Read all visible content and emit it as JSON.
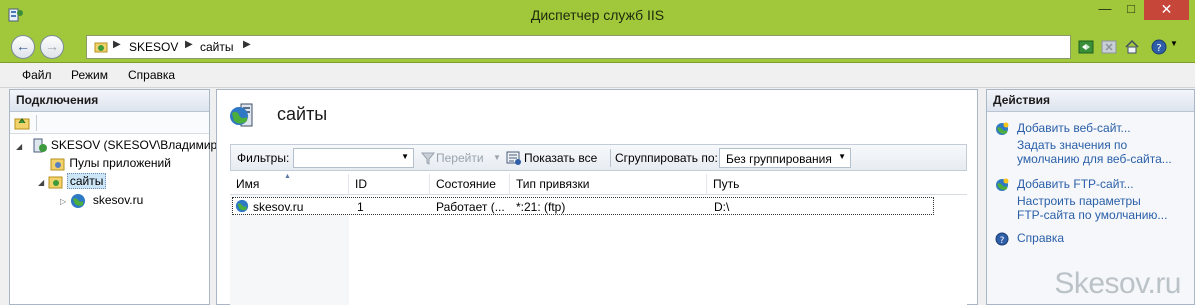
{
  "window": {
    "title": "Диспетчер служб IIS",
    "minimize": "—",
    "maximize": "□",
    "close": "✕"
  },
  "nav": {
    "back": "←",
    "forward": "→",
    "breadcrumbs": [
      "SKESOV",
      "сайты"
    ],
    "separator": "▶"
  },
  "menu": {
    "items": [
      "Файл",
      "Режим",
      "Справка"
    ]
  },
  "connections": {
    "header": "Подключения",
    "tree": {
      "server": "SKESOV (SKESOV\\Владимир)",
      "app_pools": "Пулы приложений",
      "sites": "сайты",
      "site1": "skesov.ru"
    }
  },
  "main": {
    "title": "сайты",
    "filter_label": "Фильтры:",
    "go_label": "Перейти",
    "show_all_label": "Показать все",
    "group_label": "Сгруппировать по:",
    "group_value": "Без группирования",
    "columns": [
      "Имя",
      "ID",
      "Состояние",
      "Тип привязки",
      "Путь"
    ],
    "rows": [
      {
        "name": "skesov.ru",
        "id": "1",
        "state": "Работает (...",
        "binding": "*:21: (ftp)",
        "path": "D:\\"
      }
    ]
  },
  "actions": {
    "header": "Действия",
    "add_web_site": "Добавить веб-сайт...",
    "set_defaults_1": "Задать значения по",
    "set_defaults_2": "умолчанию для веб-сайта...",
    "add_ftp_site": "Добавить FTP-сайт...",
    "ftp_defaults_1": "Настроить параметры",
    "ftp_defaults_2": "FTP-сайта по умолчанию...",
    "help": "Справка"
  },
  "watermark": "Skesov.ru",
  "colors": {
    "titlebar": "#a1c83a",
    "close": "#c7463a",
    "link": "#2a5fa8",
    "selection": "#cde6f7"
  }
}
